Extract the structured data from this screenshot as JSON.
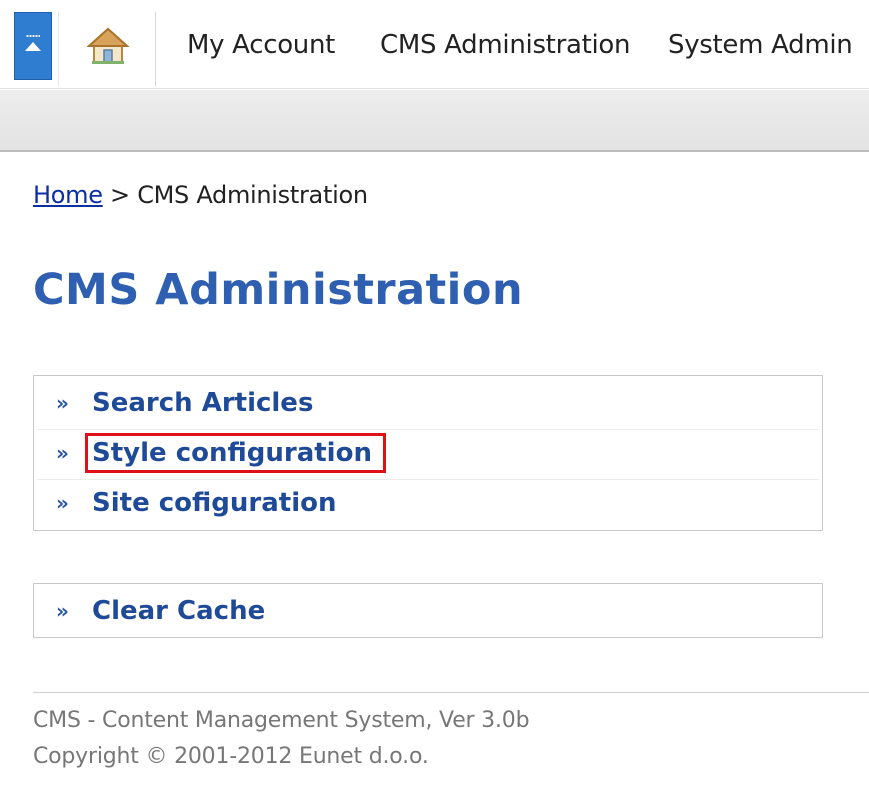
{
  "nav": {
    "collapse_icon": "collapse-up-icon",
    "home_icon": "home-icon",
    "items": [
      {
        "label": "My Account"
      },
      {
        "label": "CMS Administration"
      },
      {
        "label": "System Admin"
      }
    ],
    "accent_color": "#2f7dd1"
  },
  "breadcrumb": {
    "home": "Home",
    "separator": ">",
    "current": "CMS Administration"
  },
  "page": {
    "title": "CMS Administration",
    "title_color": "#2e5fb0"
  },
  "menu": {
    "bullet": "»",
    "items": [
      {
        "label": "Search Articles"
      },
      {
        "label": "Style configuration",
        "highlighted": true
      },
      {
        "label": "Site cofiguration"
      }
    ],
    "cache": [
      {
        "label": "Clear Cache"
      }
    ],
    "highlight_color": "#e0101a"
  },
  "footer": {
    "line1": "CMS - Content Management System, Ver 3.0b",
    "line2": "Copyright © 2001-2012 Eunet d.o.o."
  }
}
